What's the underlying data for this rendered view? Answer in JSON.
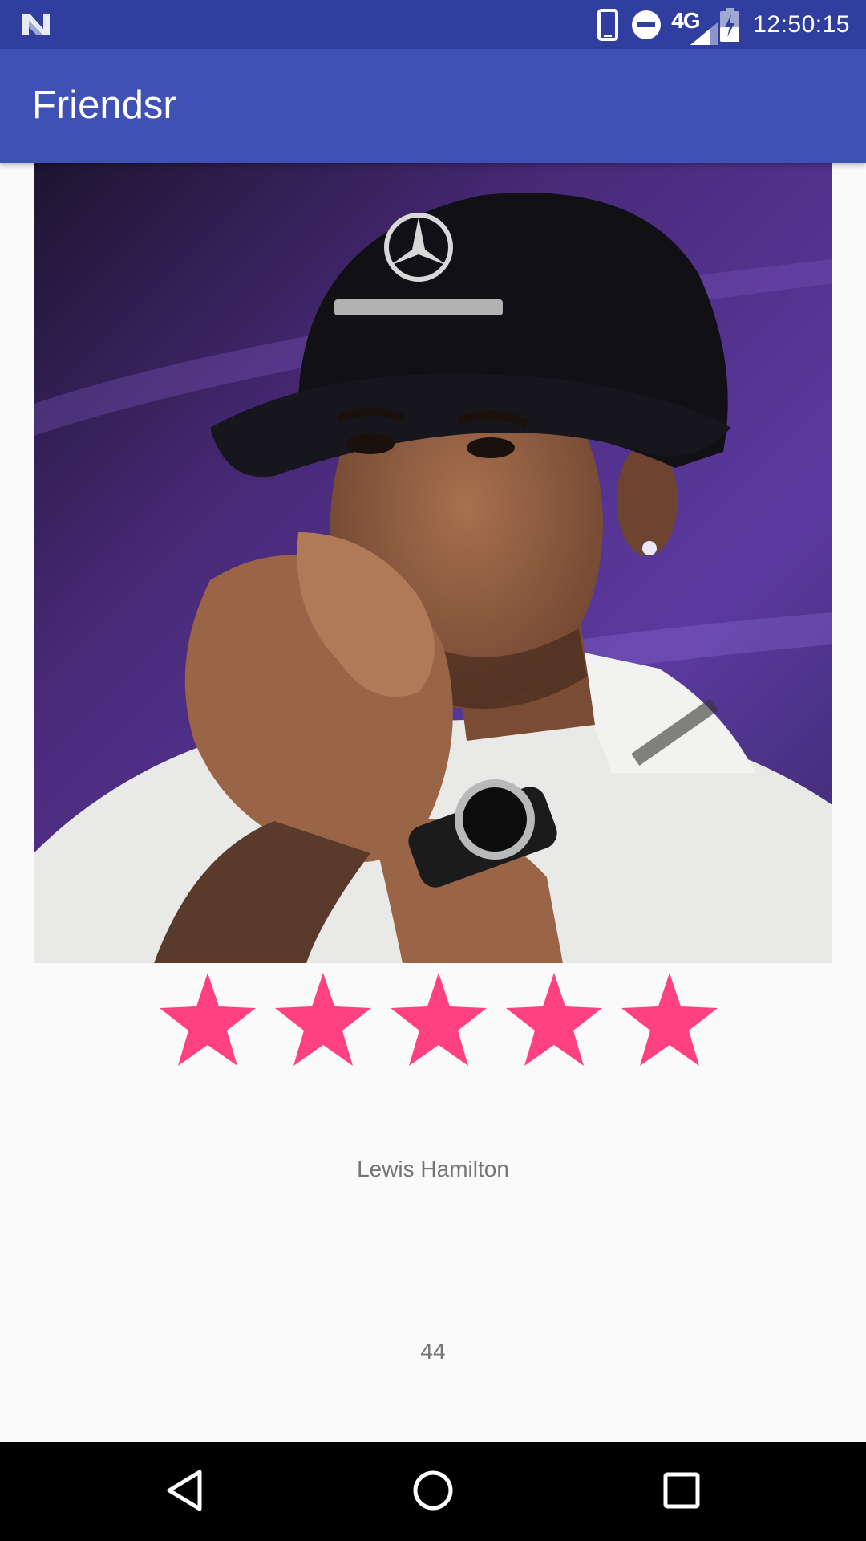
{
  "status_bar": {
    "network_label": "4G",
    "time": "12:50:15",
    "icons": [
      "notification-n-icon",
      "device-icon",
      "do-not-disturb-icon",
      "signal-icon",
      "battery-charging-icon"
    ]
  },
  "app_bar": {
    "title": "Friendsr"
  },
  "profile": {
    "photo_icon": "profile-photo",
    "rating": {
      "value": 5,
      "max": 5,
      "star_color": "#FF4081"
    },
    "name": "Lewis Hamilton",
    "age": "44"
  },
  "nav_bar": {
    "icons": [
      "back-icon",
      "home-icon",
      "recents-icon"
    ]
  },
  "colors": {
    "status_bar": "#303F9F",
    "app_bar": "#3F51B5",
    "accent": "#FF4081",
    "background": "#FAFAFA"
  }
}
